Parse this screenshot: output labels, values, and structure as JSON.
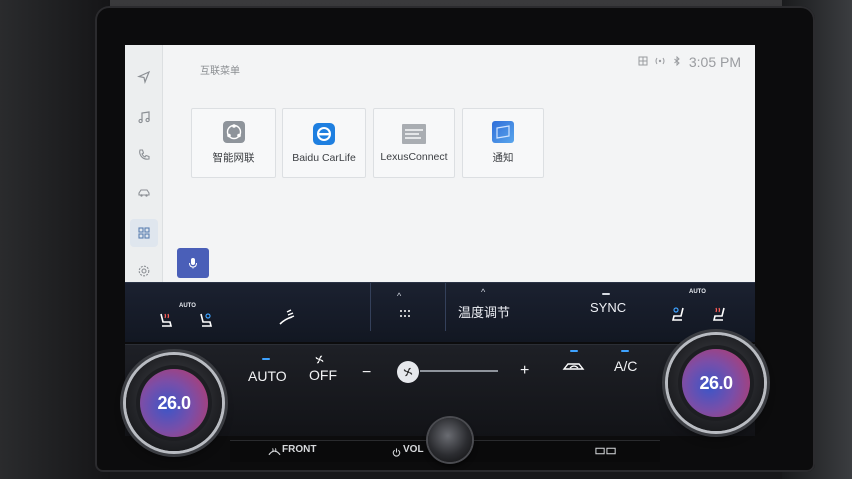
{
  "screen": {
    "title": "互联菜单",
    "time": "3:05 PM"
  },
  "rail": {
    "items": [
      {
        "icon": "navigation-icon"
      },
      {
        "icon": "music-note-icon"
      },
      {
        "icon": "phone-icon"
      },
      {
        "icon": "car-icon"
      },
      {
        "icon": "apps-grid-icon",
        "active": true
      },
      {
        "icon": "gear-icon"
      }
    ]
  },
  "apps": [
    {
      "label": "智能网联",
      "icon": "smart-connect-icon"
    },
    {
      "label": "Baidu CarLife",
      "icon": "carlife-icon"
    },
    {
      "label": "LexusConnect",
      "icon": "lexusconnect-icon"
    },
    {
      "label": "通知",
      "icon": "notification-icon"
    }
  ],
  "climate_strip": {
    "auto_left": "AUTO",
    "title": "温度调节",
    "sync": "SYNC",
    "auto_right": "AUTO"
  },
  "climate_hw": {
    "auto": "AUTO",
    "off": "OFF",
    "minus": "−",
    "plus": "+",
    "ac": "A/C",
    "left_temp": "26.0",
    "right_temp": "26.0"
  },
  "bottom": {
    "front": "FRONT",
    "vol": "VOL"
  },
  "colors": {
    "accent_blue": "#3ea2ff",
    "mic_button": "#4a5fb8"
  }
}
